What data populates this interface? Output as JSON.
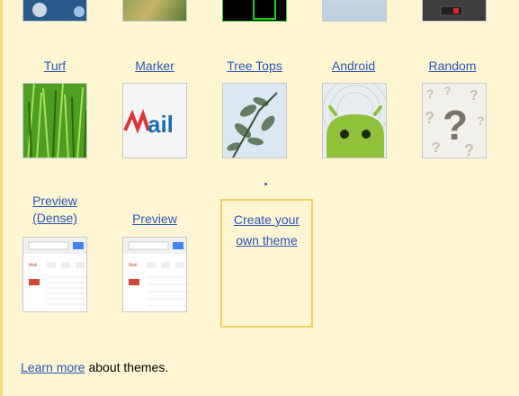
{
  "themes_row2": [
    {
      "label": "Turf"
    },
    {
      "label": "Marker"
    },
    {
      "label": "Tree Tops"
    },
    {
      "label": "Android"
    },
    {
      "label": "Random"
    }
  ],
  "preview_dense": {
    "line1": "Preview",
    "line2": "(Dense)"
  },
  "preview": {
    "label": "Preview"
  },
  "create_theme": {
    "line1": "Create your",
    "line2": "own theme"
  },
  "footer": {
    "link": "Learn more",
    "text": " about themes."
  },
  "marker_text": "ail",
  "preview_mail_label": "Mail",
  "colors": {
    "link": "#2a57b8",
    "background": "#fef5d3",
    "highlight_border": "#f4cf62"
  },
  "icons": [
    "question-mark-icon",
    "android-robot-icon",
    "search-icon"
  ]
}
